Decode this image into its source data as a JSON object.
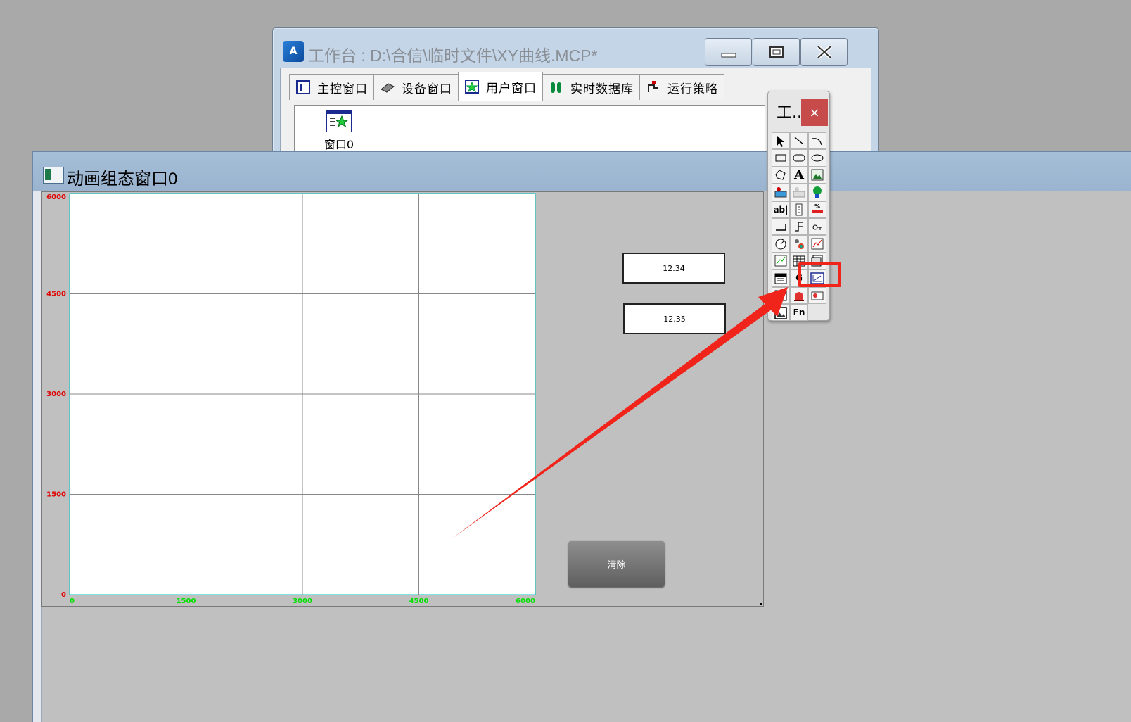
{
  "workbench": {
    "title": "工作台 : D:\\合信\\临时文件\\XY曲线.MCP*",
    "app_icon": "mcgs-logo-icon",
    "caption_buttons": [
      "minimize-icon",
      "restore-icon",
      "close-icon"
    ],
    "tabs": [
      {
        "label": "主控窗口",
        "icon": "main-window-icon",
        "active": false
      },
      {
        "label": "设备窗口",
        "icon": "device-icon",
        "active": false
      },
      {
        "label": "用户窗口",
        "icon": "user-window-icon",
        "active": true
      },
      {
        "label": "实时数据库",
        "icon": "database-icon",
        "active": false
      },
      {
        "label": "运行策略",
        "icon": "strategy-icon",
        "active": false
      }
    ],
    "windows": [
      {
        "label": "窗口0",
        "icon": "window-star-icon"
      }
    ]
  },
  "anim_window": {
    "title": "动画组态窗口0",
    "value_box_1": "12.34",
    "value_box_2": "12.35",
    "clear_button": "清除"
  },
  "chart_data": {
    "type": "line",
    "title": "",
    "xlabel": "",
    "ylabel": "",
    "x_ticks": [
      "0",
      "1500",
      "3000",
      "4500",
      "6000"
    ],
    "y_ticks": [
      "0",
      "1500",
      "3000",
      "4500",
      "6000"
    ],
    "xlim": [
      0,
      6000
    ],
    "ylim": [
      0,
      6000
    ],
    "grid": true,
    "series": [],
    "colors": {
      "x_tick": "#00e000",
      "y_tick": "#e00000",
      "frame": "#00c8c8",
      "grid": "#888888"
    }
  },
  "toolbox": {
    "title": "工...",
    "close": "×",
    "tools": [
      {
        "name": "pointer-icon"
      },
      {
        "name": "line-icon"
      },
      {
        "name": "arc-icon"
      },
      {
        "name": "rectangle-icon"
      },
      {
        "name": "rounded-rect-icon"
      },
      {
        "name": "ellipse-icon"
      },
      {
        "name": "polygon-icon"
      },
      {
        "name": "text-icon",
        "text": "A"
      },
      {
        "name": "bitmap-icon"
      },
      {
        "name": "flow-block-icon"
      },
      {
        "name": "pipe-icon"
      },
      {
        "name": "element-library-icon"
      },
      {
        "name": "input-box-icon",
        "text": "ab|"
      },
      {
        "name": "slider-icon"
      },
      {
        "name": "percent-fill-icon"
      },
      {
        "name": "standard-button-icon"
      },
      {
        "name": "step-button-icon"
      },
      {
        "name": "switch-icon"
      },
      {
        "name": "gauge-icon"
      },
      {
        "name": "rotary-icon"
      },
      {
        "name": "realtime-curve-icon"
      },
      {
        "name": "history-curve-icon"
      },
      {
        "name": "table-icon"
      },
      {
        "name": "storage-table-icon"
      },
      {
        "name": "report-icon"
      },
      {
        "name": "g-icon",
        "text": "G"
      },
      {
        "name": "xy-curve-icon"
      },
      {
        "name": "alarm-table-icon"
      },
      {
        "name": "alarm-light-icon"
      },
      {
        "name": "alarm-strip-icon"
      },
      {
        "name": "picture-icon"
      },
      {
        "name": "function-icon",
        "text": "Fn"
      }
    ]
  }
}
